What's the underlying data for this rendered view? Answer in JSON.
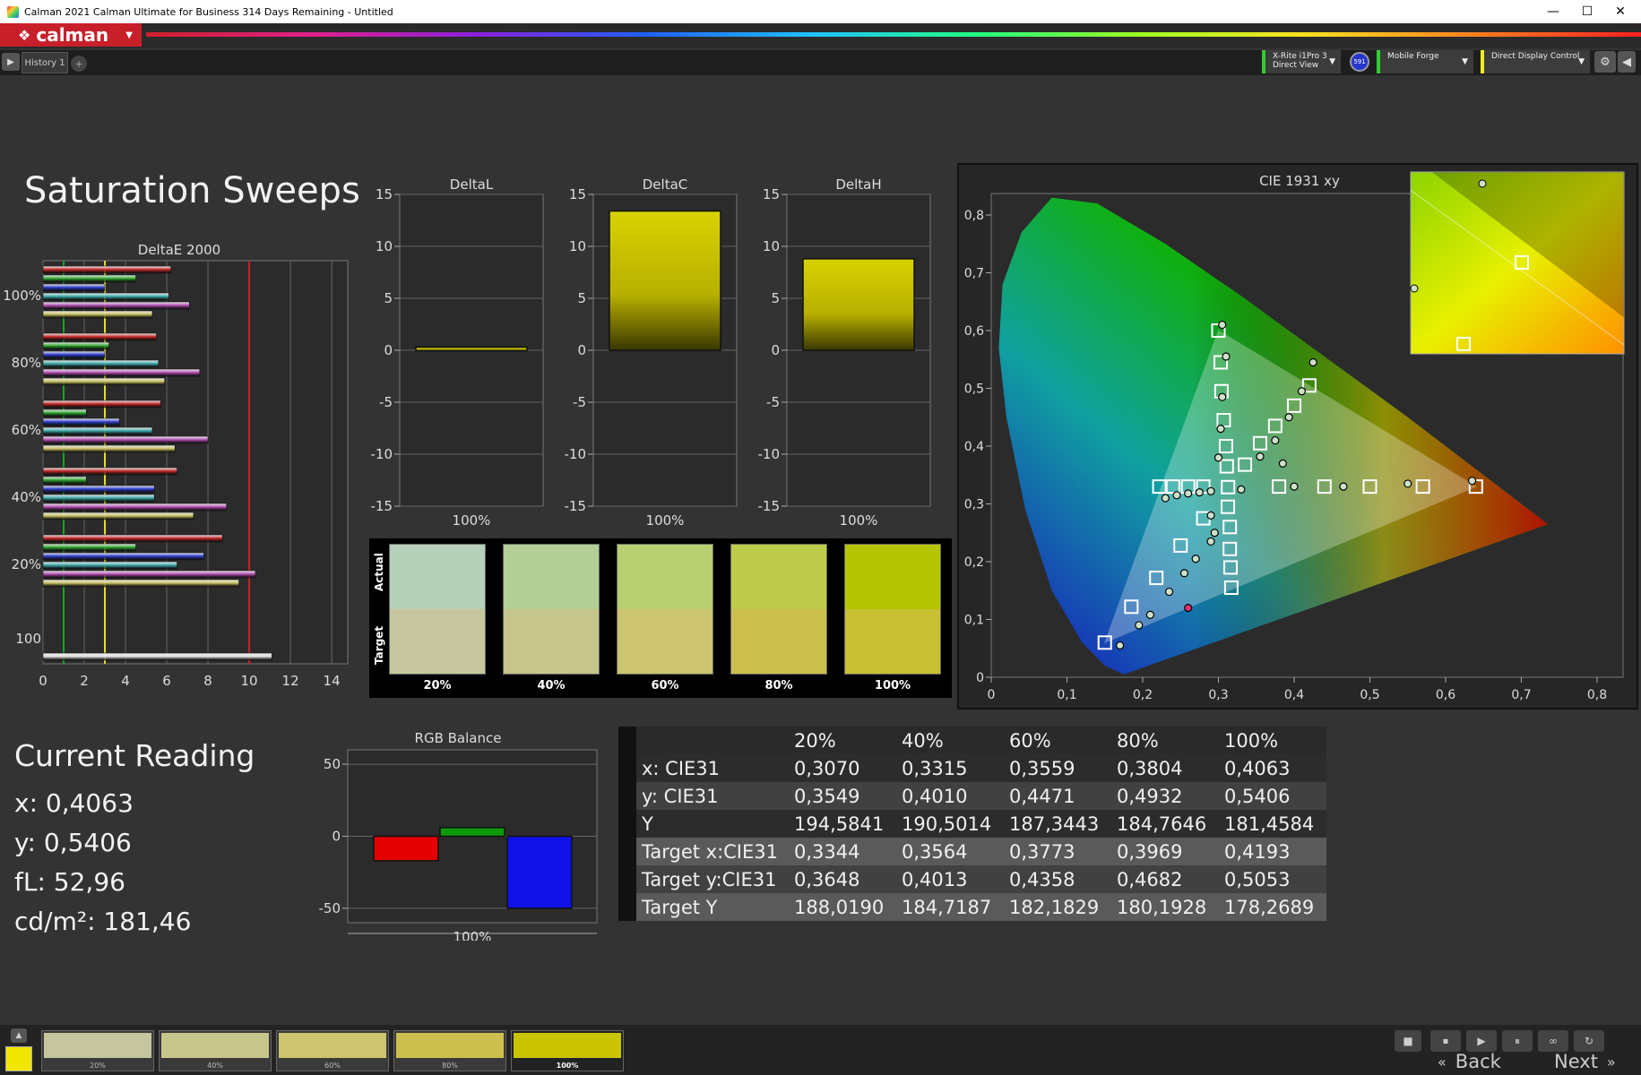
{
  "window": {
    "title": "Calman 2021 Calman Ultimate for Business 314 Days Remaining  - Untitled",
    "controls": [
      "—",
      "☐",
      "✕"
    ]
  },
  "menubar": {
    "logo_text": "calman"
  },
  "tabs": {
    "items": [
      "History 1"
    ],
    "add_label": "+"
  },
  "devices": {
    "meter_line1": "X-Rite i1Pro 3",
    "meter_line2": "Direct View",
    "meter_badge": "591",
    "source": "Mobile Forge",
    "display": "Direct Display Control"
  },
  "page": {
    "title": "Saturation Sweeps"
  },
  "deltae": {
    "title": "DeltaE 2000",
    "xticks": [
      "0",
      "2",
      "4",
      "6",
      "8",
      "10",
      "12",
      "14"
    ],
    "yticks": [
      "100%",
      "80%",
      "60%",
      "40%",
      "20%",
      "100"
    ],
    "groups": [
      {
        "values": [
          6.2,
          4.5,
          3.0,
          6.1,
          7.1,
          5.3
        ]
      },
      {
        "values": [
          5.5,
          3.2,
          3.0,
          5.6,
          7.6,
          5.9
        ]
      },
      {
        "values": [
          5.7,
          2.1,
          3.7,
          5.3,
          8.0,
          6.4
        ]
      },
      {
        "values": [
          6.5,
          2.1,
          5.4,
          5.4,
          8.9,
          7.3
        ]
      },
      {
        "values": [
          8.7,
          4.5,
          7.8,
          6.5,
          10.3,
          9.5
        ]
      },
      {
        "values": [
          11.1
        ]
      }
    ],
    "threshold_green": 1,
    "threshold_yellow": 3,
    "threshold_red": 10
  },
  "delta_charts": [
    {
      "title": "DeltaL",
      "value": 0.3,
      "xlabel": "100%"
    },
    {
      "title": "DeltaC",
      "value": 13.4,
      "xlabel": "100%"
    },
    {
      "title": "DeltaH",
      "value": 8.8,
      "xlabel": "100%"
    }
  ],
  "delta_yticks": [
    "15",
    "10",
    "5",
    "0",
    "-5",
    "-10",
    "-15"
  ],
  "swatches": {
    "actual_label": "Actual",
    "target_label": "Target",
    "items": [
      {
        "label": "20%",
        "actual": "#b7d0b9",
        "target": "#c5c59e"
      },
      {
        "label": "40%",
        "actual": "#b3cf96",
        "target": "#c6c58b"
      },
      {
        "label": "60%",
        "actual": "#b9d071",
        "target": "#ccc46e"
      },
      {
        "label": "80%",
        "actual": "#bccb49",
        "target": "#ccbf4e"
      },
      {
        "label": "100%",
        "actual": "#b5c500",
        "target": "#c9c034"
      }
    ]
  },
  "cie": {
    "title": "CIE 1931 xy",
    "xticks": [
      "0",
      "0,1",
      "0,2",
      "0,3",
      "0,4",
      "0,5",
      "0,6",
      "0,7",
      "0,8"
    ],
    "yticks": [
      "0",
      "0,1",
      "0,2",
      "0,3",
      "0,4",
      "0,5",
      "0,6",
      "0,7",
      "0,8"
    ]
  },
  "current_reading": {
    "title": "Current Reading",
    "x": "x: 0,4063",
    "y": "y: 0,5406",
    "fl": "fL: 52,96",
    "cdm2": "cd/m²: 181,46"
  },
  "rgb_balance": {
    "title": "RGB Balance",
    "yticks": [
      "50",
      "0",
      "-50"
    ],
    "xlabel": "100%",
    "values": {
      "r": -17,
      "g": 6,
      "b": -50
    }
  },
  "table": {
    "headers": [
      "",
      "20%",
      "40%",
      "60%",
      "80%",
      "100%"
    ],
    "rows": [
      [
        "x: CIE31",
        "0,3070",
        "0,3315",
        "0,3559",
        "0,3804",
        "0,4063"
      ],
      [
        "y: CIE31",
        "0,3549",
        "0,4010",
        "0,4471",
        "0,4932",
        "0,5406"
      ],
      [
        "Y",
        "194,5841",
        "190,5014",
        "187,3443",
        "184,7646",
        "181,4584"
      ],
      [
        "Target x:CIE31",
        "0,3344",
        "0,3564",
        "0,3773",
        "0,3969",
        "0,4193"
      ],
      [
        "Target y:CIE31",
        "0,3648",
        "0,4013",
        "0,4358",
        "0,4682",
        "0,5053"
      ],
      [
        "Target Y",
        "188,0190",
        "184,7187",
        "182,1829",
        "180,1928",
        "178,2689"
      ]
    ]
  },
  "bottom": {
    "current_color": "#f1e600",
    "patches": [
      {
        "label": "20%",
        "color": "#c5c59e"
      },
      {
        "label": "40%",
        "color": "#c6c58b"
      },
      {
        "label": "60%",
        "color": "#ccc46e"
      },
      {
        "label": "80%",
        "color": "#ccbf4e"
      },
      {
        "label": "100%",
        "color": "#c9c300"
      }
    ],
    "back_label": "Back",
    "next_label": "Next"
  }
}
